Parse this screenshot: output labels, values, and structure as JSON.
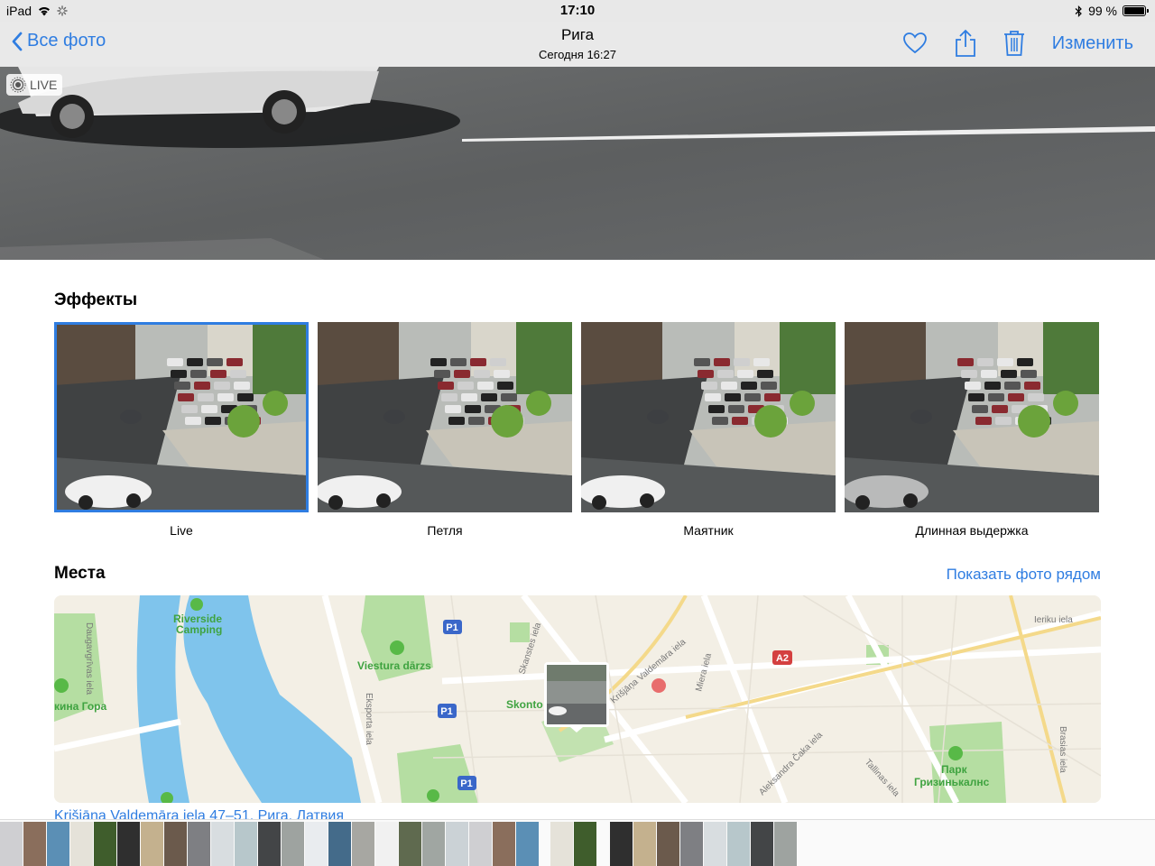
{
  "status_bar": {
    "device": "iPad",
    "time": "17:10",
    "battery": "99 %",
    "battery_level": 0.99
  },
  "nav": {
    "back_label": "Все фото",
    "title": "Рига",
    "subtitle": "Сегодня  16:27",
    "edit_label": "Изменить",
    "icons": [
      "heart-icon",
      "share-icon",
      "trash-icon"
    ]
  },
  "photo": {
    "live_badge": "LIVE"
  },
  "effects": {
    "title": "Эффекты",
    "selected": 0,
    "items": [
      {
        "label": "Live"
      },
      {
        "label": "Петля"
      },
      {
        "label": "Маятник"
      },
      {
        "label": "Длинная выдержка"
      }
    ]
  },
  "places": {
    "title": "Места",
    "show_nearby": "Показать фото рядом",
    "address": "Krišjāņa Valdemāra iela 47–51, Рига, Латвия",
    "map_labels": {
      "riverside": "Riverside",
      "camping": "Camping",
      "viestura": "Viestura dārzs",
      "skonto": "Skonto",
      "daugavgrivas": "Daugavgrīvas iela",
      "gora": "кина Гора",
      "eksporta": "Eksporta iela",
      "skanstes": "Skanstes iela",
      "valdemara": "Krišjāņa Valdemāra iela",
      "miera": "Miera iela",
      "ieriku": "Ieriku iela",
      "aleksandra": "Aleksandra Čaka iela",
      "tallinas": "Tallinas iela",
      "brasias": "Brasias iela",
      "park1": "Парк",
      "park2": "Гризинькалнс",
      "p1": "P1",
      "a2": "A2"
    }
  },
  "colors": {
    "accent": "#2f7de1"
  }
}
